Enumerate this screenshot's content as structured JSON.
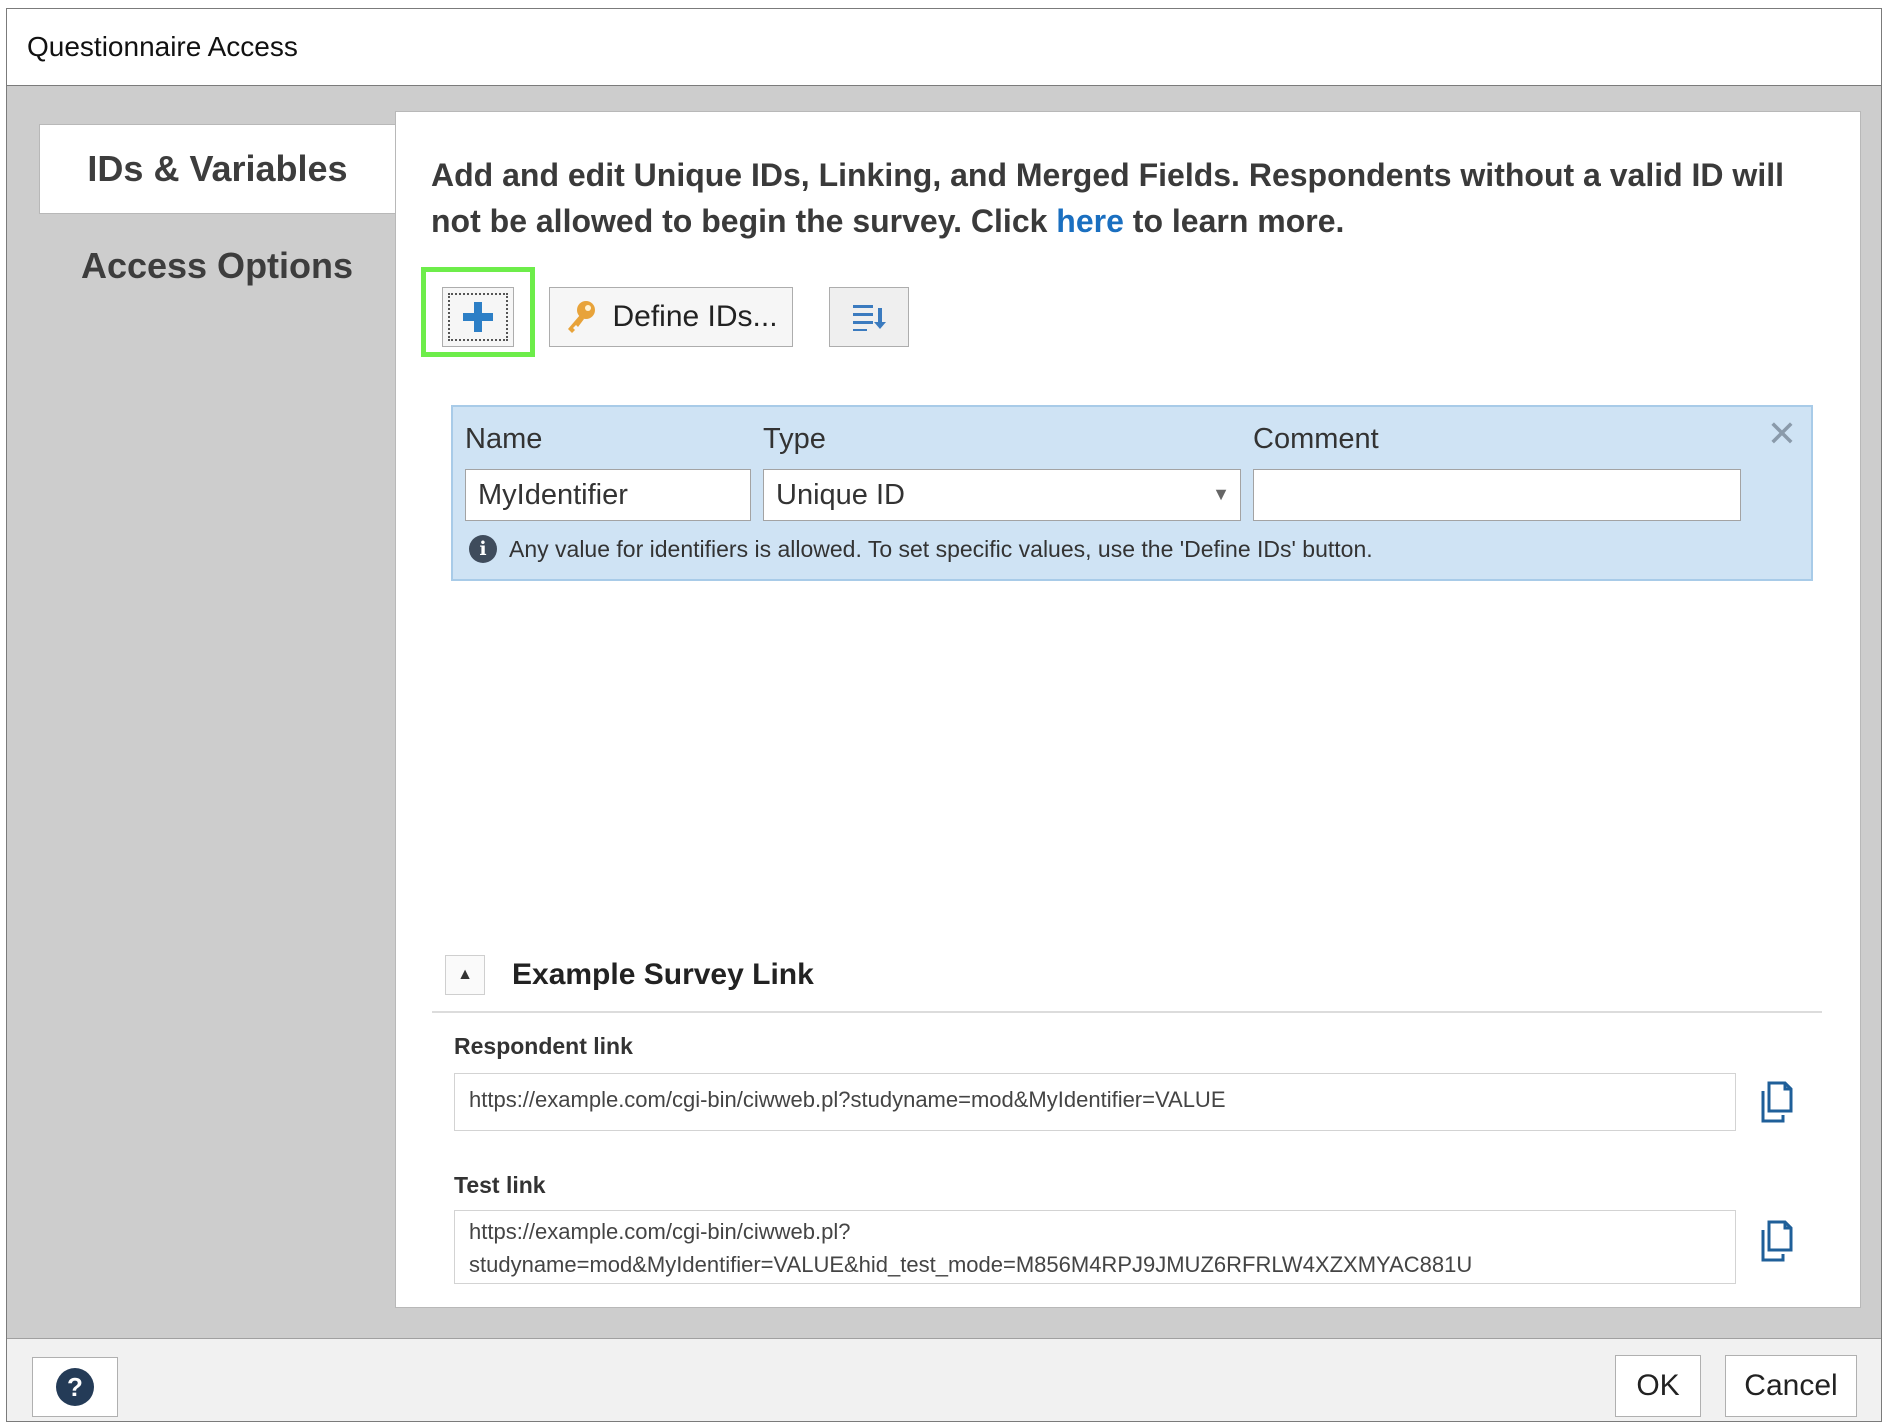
{
  "window": {
    "title": "Questionnaire Access"
  },
  "tabs": [
    {
      "label": "IDs & Variables",
      "active": true
    },
    {
      "label": "Access Options",
      "active": false
    }
  ],
  "intro": {
    "text_before": "Add and edit Unique IDs, Linking, and Merged Fields. Respondents without a valid ID will not be allowed to begin the survey. Click ",
    "link_text": "here",
    "text_after": " to learn more."
  },
  "toolbar": {
    "add_icon": "plus-icon",
    "define_label": "Define IDs...",
    "define_icon": "key-icon",
    "sort_icon": "sort-list-icon"
  },
  "identifier": {
    "name_label": "Name",
    "type_label": "Type",
    "comment_label": "Comment",
    "name_value": "MyIdentifier",
    "type_value": "Unique ID",
    "comment_value": "",
    "info_text": "Any value for identifiers is allowed. To set specific values, use the 'Define IDs' button."
  },
  "example": {
    "title": "Example Survey Link",
    "respondent_label": "Respondent link",
    "respondent_url": "https://example.com/cgi-bin/ciwweb.pl?studyname=mod&MyIdentifier=VALUE",
    "test_label": "Test link",
    "test_url_line1": "https://example.com/cgi-bin/ciwweb.pl?",
    "test_url_line2": "studyname=mod&MyIdentifier=VALUE&hid_test_mode=M856M4RPJ9JMUZ6RFRLW4XZXMYAC881U"
  },
  "footer": {
    "help_symbol": "?",
    "ok_label": "OK",
    "cancel_label": "Cancel"
  },
  "colors": {
    "highlight": "#6ded4a",
    "link": "#1a6fc0",
    "card_bg": "#cfe3f4",
    "plus": "#2d7fc6",
    "key": "#e8a33a"
  }
}
